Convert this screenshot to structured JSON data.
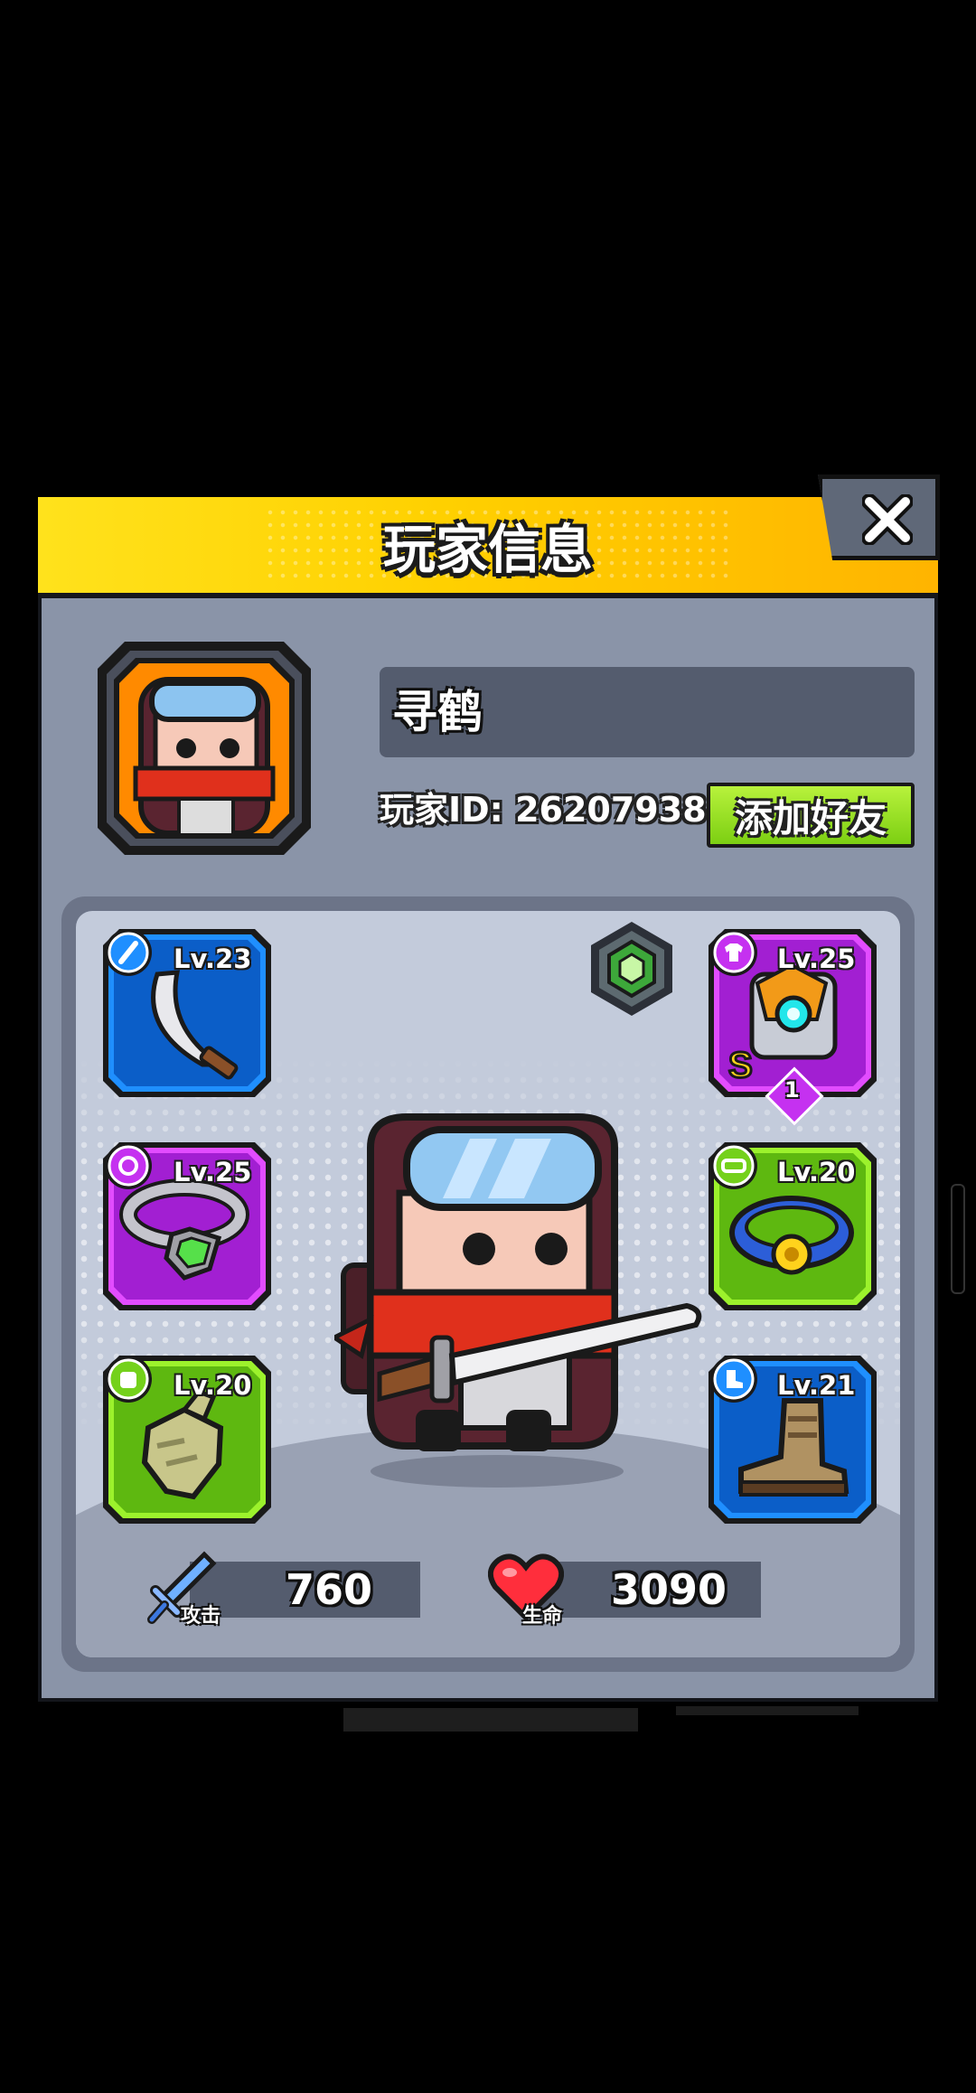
{
  "dialog": {
    "title": "玩家信息",
    "close_icon": "close-x-icon"
  },
  "player": {
    "name": "寻鹤",
    "id_text": "玩家ID: 26207938",
    "add_friend_label": "添加好友",
    "avatar_icon": "ninja-avatar-icon",
    "rank_icon": "green-hexagon-rank-icon"
  },
  "equipment": {
    "weapon": {
      "level": "Lv.23",
      "icon": "scimitar-icon",
      "category_icon": "blade-category-icon",
      "rarity_color": "#1f8fff"
    },
    "armor": {
      "level": "Lv.25",
      "icon": "mech-armor-icon",
      "category_icon": "shirt-category-icon",
      "grade": "S",
      "star": "1",
      "rarity_color": "#c531f0"
    },
    "ring": {
      "level": "Lv.25",
      "icon": "emerald-ring-icon",
      "category_icon": "ring-category-icon",
      "rarity_color": "#c531f0"
    },
    "belt": {
      "level": "Lv.20",
      "icon": "belt-icon",
      "category_icon": "belt-category-icon",
      "rarity_color": "#74d11b"
    },
    "gloves": {
      "level": "Lv.20",
      "icon": "glove-icon",
      "category_icon": "hand-category-icon",
      "rarity_color": "#74d11b"
    },
    "boots": {
      "level": "Lv.21",
      "icon": "boot-icon",
      "category_icon": "boot-category-icon",
      "rarity_color": "#1f8fff"
    }
  },
  "stats": {
    "attack": {
      "label": "攻击",
      "value": "760",
      "icon": "sword-icon"
    },
    "health": {
      "label": "生命",
      "value": "3090",
      "icon": "heart-icon"
    }
  },
  "colors": {
    "header_yellow": "#ffd000",
    "panel_gray": "#8a94a8",
    "add_button_green": "#8ad61a",
    "rare_blue": "#1f8fff",
    "epic_purple": "#c531f0",
    "uncommon_green": "#74d11b"
  }
}
